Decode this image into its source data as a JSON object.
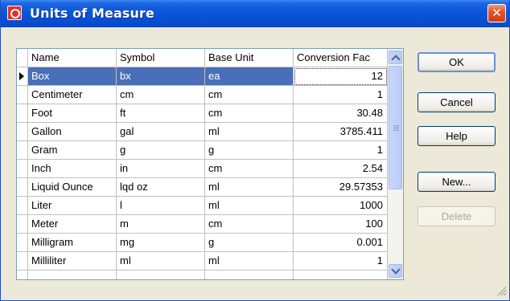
{
  "window": {
    "title": "Units of Measure",
    "close_glyph": "✕"
  },
  "grid": {
    "columns": [
      "Name",
      "Symbol",
      "Base Unit",
      "Conversion Fac"
    ],
    "rows": [
      {
        "name": "Box",
        "symbol": "bx",
        "base_unit": "ea",
        "conversion": "12"
      },
      {
        "name": "Centimeter",
        "symbol": "cm",
        "base_unit": "cm",
        "conversion": "1"
      },
      {
        "name": "Foot",
        "symbol": "ft",
        "base_unit": "cm",
        "conversion": "30.48"
      },
      {
        "name": "Gallon",
        "symbol": "gal",
        "base_unit": "ml",
        "conversion": "3785.411"
      },
      {
        "name": "Gram",
        "symbol": "g",
        "base_unit": "g",
        "conversion": "1"
      },
      {
        "name": "Inch",
        "symbol": "in",
        "base_unit": "cm",
        "conversion": "2.54"
      },
      {
        "name": "Liquid Ounce",
        "symbol": "lqd oz",
        "base_unit": "ml",
        "conversion": "29.57353"
      },
      {
        "name": "Liter",
        "symbol": "l",
        "base_unit": "ml",
        "conversion": "1000"
      },
      {
        "name": "Meter",
        "symbol": "m",
        "base_unit": "cm",
        "conversion": "100"
      },
      {
        "name": "Milligram",
        "symbol": "mg",
        "base_unit": "g",
        "conversion": "0.001"
      },
      {
        "name": "Milliliter",
        "symbol": "ml",
        "base_unit": "ml",
        "conversion": "1"
      }
    ]
  },
  "buttons": {
    "ok": "OK",
    "cancel": "Cancel",
    "help": "Help",
    "new": "New...",
    "delete": "Delete"
  },
  "colors": {
    "titlebar": "#0a55d8",
    "selection": "#4a6fb9",
    "close_button": "#e2552c"
  }
}
